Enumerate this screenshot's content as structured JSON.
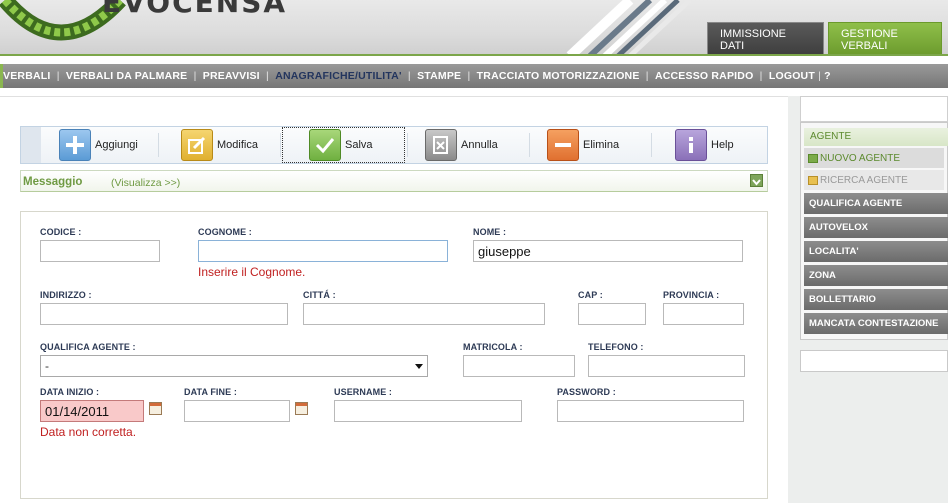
{
  "header": {
    "logo_text": "EVOCENSA",
    "tabs": [
      {
        "label": "IMMISSIONE DATI",
        "active": false
      },
      {
        "label": "GESTIONE VERBALI",
        "active": true
      }
    ]
  },
  "nav": {
    "items": [
      "VERBALI",
      "VERBALI DA PALMARE",
      "PREAVVISI",
      "ANAGRAFICHE/UTILITA'",
      "STAMPE",
      "TRACCIATO MOTORIZZAZIONE",
      "ACCESSO RAPIDO",
      "LOGOUT",
      "?"
    ],
    "active": "ANAGRAFICHE/UTILITA'"
  },
  "toolbar": {
    "buttons": [
      {
        "label": "Aggiungi",
        "icon": "plus-icon",
        "color": "#5b9bd5"
      },
      {
        "label": "Modifica",
        "icon": "edit-icon",
        "color": "#e0b030"
      },
      {
        "label": "Salva",
        "icon": "check-icon",
        "color": "#6fb040"
      },
      {
        "label": "Annulla",
        "icon": "cancel-icon",
        "color": "#8a8a8a"
      },
      {
        "label": "Elimina",
        "icon": "minus-icon",
        "color": "#e07030"
      },
      {
        "label": "Help",
        "icon": "info-icon",
        "color": "#8a70b8"
      }
    ]
  },
  "message": {
    "title": "Messaggio",
    "link": "(Visualizza >>)"
  },
  "form": {
    "codice": {
      "label": "CODICE :",
      "value": ""
    },
    "cognome": {
      "label": "COGNOME :",
      "value": "",
      "error": "Inserire il Cognome."
    },
    "nome": {
      "label": "NOME :",
      "value": "giuseppe"
    },
    "indirizzo": {
      "label": "INDIRIZZO :",
      "value": ""
    },
    "citta": {
      "label": "CITTÁ :",
      "value": ""
    },
    "cap": {
      "label": "CAP :",
      "value": ""
    },
    "provincia": {
      "label": "PROVINCIA :",
      "value": ""
    },
    "qualifica": {
      "label": "QUALIFICA AGENTE :",
      "value": "-"
    },
    "matricola": {
      "label": "MATRICOLA :",
      "value": ""
    },
    "telefono": {
      "label": "TELEFONO :",
      "value": ""
    },
    "data_inizio": {
      "label": "DATA INIZIO :",
      "value": "01/14/2011",
      "error": "Data non corretta."
    },
    "data_fine": {
      "label": "DATA FINE :",
      "value": ""
    },
    "username": {
      "label": "USERNAME :",
      "value": ""
    },
    "password": {
      "label": "PASSWORD :",
      "value": ""
    }
  },
  "sidebar": {
    "header": "AGENTE",
    "sub": [
      {
        "label": "NUOVO AGENTE",
        "active": true
      },
      {
        "label": "RICERCA AGENTE",
        "active": false
      }
    ],
    "items": [
      "QUALIFICA AGENTE",
      "AUTOVELOX",
      "LOCALITA'",
      "ZONA",
      "BOLLETTARIO",
      "MANCATA CONTESTAZIONE"
    ]
  },
  "colors": {
    "accent_green": "#7ca64a",
    "error_red": "#c02020",
    "nav_active": "#23355e"
  }
}
